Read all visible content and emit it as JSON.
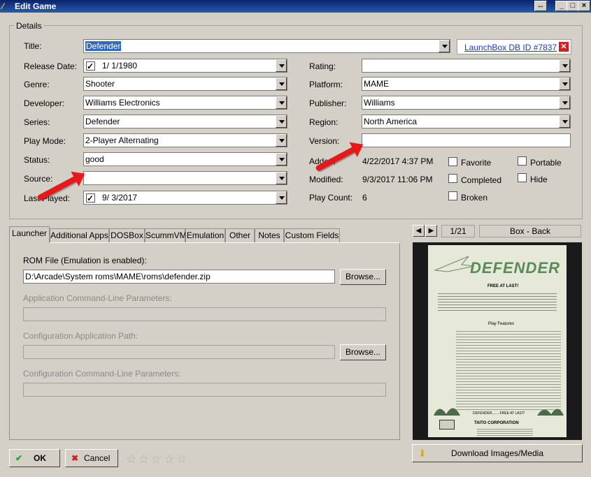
{
  "window": {
    "title": "Edit Game",
    "controls": [
      "↔",
      "_",
      "□",
      "×"
    ]
  },
  "details": {
    "legend": "Details",
    "title": {
      "label": "Title:",
      "value": "Defender"
    },
    "db_link": "LaunchBox DB ID #7837",
    "release_date": {
      "label": "Release Date:",
      "value": "1/  1/1980"
    },
    "genre": {
      "label": "Genre:",
      "value": "Shooter"
    },
    "developer": {
      "label": "Developer:",
      "value": "Williams Electronics"
    },
    "series": {
      "label": "Series:",
      "value": "Defender"
    },
    "play_mode": {
      "label": "Play Mode:",
      "value": "2-Player Alternating"
    },
    "status": {
      "label": "Status:",
      "value": "good"
    },
    "source": {
      "label": "Source:",
      "value": ""
    },
    "last_played": {
      "label": "Last Played:",
      "value": "9/  3/2017"
    },
    "rating": {
      "label": "Rating:",
      "value": ""
    },
    "platform": {
      "label": "Platform:",
      "value": "MAME"
    },
    "publisher": {
      "label": "Publisher:",
      "value": "Williams"
    },
    "region": {
      "label": "Region:",
      "value": "North America"
    },
    "version": {
      "label": "Version:",
      "value": ""
    },
    "added": {
      "label": "Added:",
      "value": "4/22/2017 4:37 PM"
    },
    "modified": {
      "label": "Modified:",
      "value": "9/3/2017 11:06 PM"
    },
    "play_count": {
      "label": "Play Count:",
      "value": "6"
    },
    "checkboxes": {
      "favorite": "Favorite",
      "completed": "Completed",
      "broken": "Broken",
      "portable": "Portable",
      "hide": "Hide"
    }
  },
  "tabs": [
    "Launcher",
    "Additional Apps",
    "DOSBox",
    "ScummVM",
    "Emulation",
    "Other",
    "Notes",
    "Custom Fields"
  ],
  "launcher": {
    "rom_label": "ROM File (Emulation is enabled):",
    "rom_value": "D:\\Arcade\\System roms\\MAME\\roms\\defender.zip",
    "browse": "Browse...",
    "app_cmd_label": "Application Command-Line Parameters:",
    "config_path_label": "Configuration Application Path:",
    "config_cmd_label": "Configuration Command-Line Parameters:"
  },
  "media": {
    "counter": "1/21",
    "type": "Box - Back",
    "download": "Download Images/Media",
    "poster": {
      "title": "DEFENDER",
      "tagline": "FREE AT LAST!",
      "heading": "Play Features",
      "company": "TAITO CORPORATION",
      "footer": "DEFENDER........FREE AT LAST!"
    }
  },
  "footer": {
    "ok": "OK",
    "cancel": "Cancel"
  },
  "colors": {
    "arrow": "#e81818",
    "title_bar": "#0a246a",
    "link": "#1a3ccc"
  }
}
